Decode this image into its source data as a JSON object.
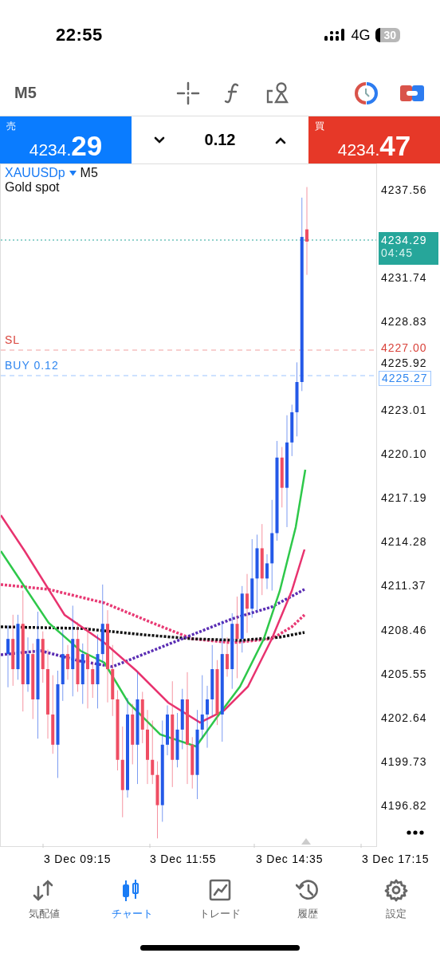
{
  "status_bar": {
    "time": "22:55",
    "network": "4G",
    "battery": "30"
  },
  "toolbar": {
    "timeframe": "M5"
  },
  "trade_bar": {
    "sell": {
      "label": "売",
      "price_main": "4234.",
      "price_big": "29"
    },
    "volume": "0.12",
    "buy": {
      "label": "買",
      "price_main": "4234.",
      "price_big": "47"
    }
  },
  "chart": {
    "symbol": "XAUUSDp",
    "timeframe": "M5",
    "description": "Gold spot",
    "bid": {
      "price": "4234.29",
      "countdown": "04:45"
    },
    "lines": [
      {
        "kind": "sl",
        "label": "SL",
        "price": "4227.00"
      },
      {
        "kind": "buy",
        "label": "BUY 0.12",
        "price": "4225.27"
      }
    ],
    "price_ticks": [
      "4237.56",
      "4231.74",
      "4228.83",
      "4225.92",
      "4223.01",
      "4220.10",
      "4217.19",
      "4214.28",
      "4211.37",
      "4208.46",
      "4205.55",
      "4202.64",
      "4199.73",
      "4196.82"
    ],
    "time_ticks": [
      "3 Dec 09:15",
      "3 Dec 11:55",
      "3 Dec 14:35",
      "3 Dec 17:15"
    ]
  },
  "tab_bar": [
    {
      "label": "気配値",
      "selected": false
    },
    {
      "label": "チャート",
      "selected": true
    },
    {
      "label": "トレード",
      "selected": false
    },
    {
      "label": "履歴",
      "selected": false
    },
    {
      "label": "設定",
      "selected": false
    }
  ]
}
